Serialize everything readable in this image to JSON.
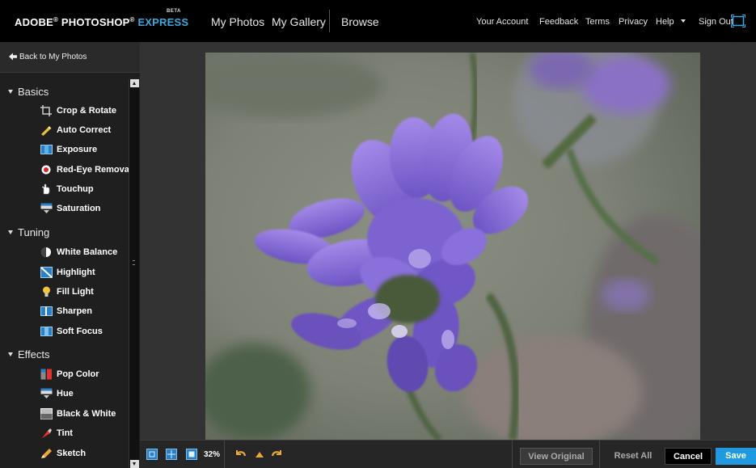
{
  "header": {
    "logo": {
      "adobe": "ADOBE",
      "photoshop": "PHOTOSHOP",
      "reg": "®",
      "express": "EXPRESS",
      "beta": "BETA"
    },
    "main_nav": [
      "My Photos",
      "My Gallery",
      "Browse"
    ],
    "top_nav": [
      "Your Account",
      "Feedback",
      "Terms",
      "Privacy",
      "Help",
      "Sign Out"
    ]
  },
  "sidebar": {
    "back_label": "Back to My Photos",
    "sections": [
      {
        "title": "Basics",
        "tools": [
          "Crop & Rotate",
          "Auto Correct",
          "Exposure",
          "Red-Eye Removal",
          "Touchup",
          "Saturation"
        ]
      },
      {
        "title": "Tuning",
        "tools": [
          "White Balance",
          "Highlight",
          "Fill Light",
          "Sharpen",
          "Soft Focus"
        ]
      },
      {
        "title": "Effects",
        "tools": [
          "Pop Color",
          "Hue",
          "Black & White",
          "Tint",
          "Sketch"
        ]
      }
    ]
  },
  "toolbar": {
    "zoom": "32%",
    "view_original": "View Original",
    "reset_all": "Reset All",
    "cancel": "Cancel",
    "save": "Save"
  },
  "icons": {
    "back": "left-arrow-icon",
    "fullscreen": "fullscreen-icon",
    "view_modes": [
      "fit-view-icon",
      "grid-view-icon",
      "actual-size-icon"
    ],
    "history": [
      "undo-icon",
      "triangle-up-icon",
      "redo-icon"
    ]
  },
  "colors": {
    "accent": "#39a9e0",
    "save_button": "#1f9ae0",
    "history_icons": "#e8a93a",
    "panel": "#1f1f1f",
    "workspace": "#333333"
  }
}
